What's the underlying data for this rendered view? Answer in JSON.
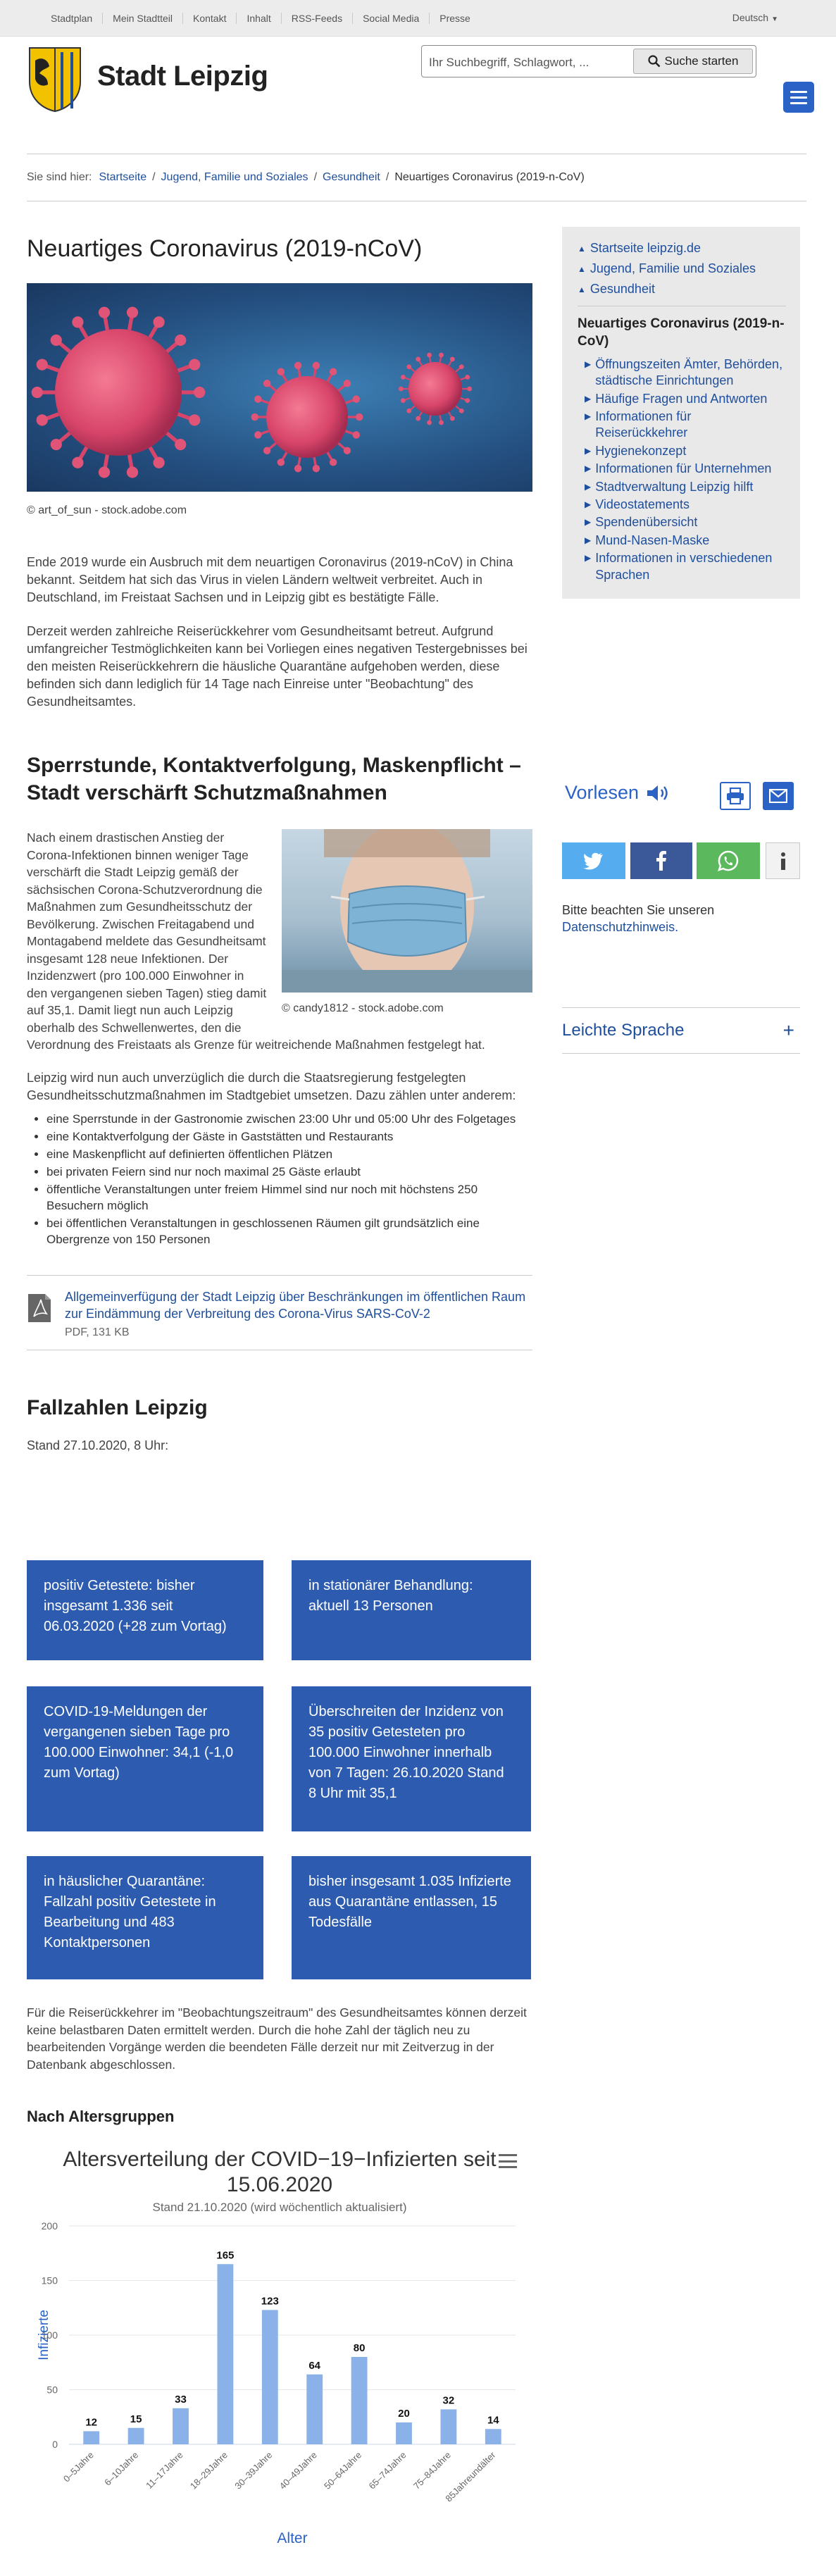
{
  "topbar": {
    "links": [
      "Stadtplan",
      "Mein Stadtteil",
      "Kontakt",
      "Inhalt",
      "RSS-Feeds",
      "Social Media",
      "Presse"
    ],
    "language": "Deutsch"
  },
  "header": {
    "brand": "Stadt Leipzig",
    "search_placeholder": "Ihr Suchbegriff, Schlagwort, ...",
    "search_button": "Suche starten"
  },
  "breadcrumb": {
    "label": "Sie sind hier:",
    "items": [
      "Startseite",
      "Jugend, Familie und Soziales",
      "Gesundheit"
    ],
    "current": "Neuartiges Coronavirus (2019-n-CoV)"
  },
  "main": {
    "title": "Neuartiges Coronavirus (2019-nCoV)",
    "hero_caption": "© art_of_sun - stock.adobe.com",
    "intro_p1": "Ende 2019 wurde ein Ausbruch mit dem neuartigen Coronavirus (2019-nCoV) in China bekannt. Seitdem hat sich das Virus in vielen Ländern weltweit verbreitet. Auch in Deutschland, im Freistaat Sachsen und in Leipzig gibt es bestätigte Fälle.",
    "intro_p2": "Derzeit werden zahlreiche Reiserückkehrer vom Gesundheitsamt betreut. Aufgrund umfangreicher Testmöglichkeiten kann bei Vorliegen eines negativen Testergebnisses bei den meisten Reiserückkehrern die häusliche Quarantäne aufgehoben werden, diese befinden sich dann lediglich für 14 Tage nach Einreise unter \"Beobachtung\" des Gesundheitsamtes.",
    "section2_title": "Sperrstunde, Kontaktverfolgung, Maskenpflicht – Stadt verschärft Schutzmaßnahmen",
    "mask_caption": "© candy1812 - stock.adobe.com",
    "section2_p1": "Nach einem drastischen Anstieg der Corona-Infektionen binnen weniger Tage verschärft die Stadt Leipzig gemäß der sächsischen Corona-Schutzverordnung die Maßnahmen zum Gesundheitsschutz der Bevölkerung. Zwischen Freitagabend und Montagabend meldete das Gesundheitsamt insgesamt 128 neue Infektionen. Der Inzidenzwert (pro 100.000 Einwohner in den vergangenen sieben Tagen) stieg damit auf 35,1. Damit liegt nun auch Leipzig oberhalb des Schwellenwertes, den die Verordnung des Freistaats als Grenze für weitreichende Maßnahmen festgelegt hat.",
    "section2_p2": "Leipzig wird nun auch unverzüglich die durch die Staatsregierung festgelegten Gesundheitsschutzmaßnahmen im Stadtgebiet umsetzen. Dazu zählen unter anderem:",
    "measures": [
      "eine Sperrstunde in der Gastronomie zwischen 23:00 Uhr und 05:00 Uhr des Folgetages",
      "eine Kontaktverfolgung der Gäste in Gaststätten und Restaurants",
      "eine Maskenpflicht auf definierten öffentlichen Plätzen",
      "bei privaten Feiern sind nur noch maximal 25 Gäste erlaubt",
      "öffentliche Veranstaltungen unter freiem Himmel sind nur noch mit höchstens 250 Besuchern möglich",
      "bei öffentlichen Veranstaltungen in geschlossenen Räumen gilt grundsätzlich eine Obergrenze von 150 Personen"
    ],
    "download_title": "Allgemeinverfügung der Stadt Leipzig über Beschränkungen im öffentlichen Raum zur Eindämmung der Verbreitung des Corona-Virus SARS-CoV-2",
    "download_meta": "PDF, 131 KB",
    "fallzahlen_title": "Fallzahlen Leipzig",
    "stand": "Stand 27.10.2020, 8 Uhr:",
    "boxes": [
      "positiv Getestete: bisher insgesamt 1.336 seit 06.03.2020 (+28 zum Vortag)",
      "in stationärer Behandlung: aktuell 13 Personen",
      "COVID-19-Meldungen der vergangenen sieben Tage pro 100.000 Einwohner: 34,1 (-1,0 zum Vortag)",
      "Überschreiten der Inzidenz von 35 positiv Getesteten pro 100.000 Einwohner innerhalb von 7 Tagen: 26.10.2020 Stand 8 Uhr mit 35,1",
      "in häuslicher Quarantäne: Fallzahl positiv Getestete in Bearbeitung und 483 Kontaktpersonen",
      "bisher insgesamt 1.035 Infizierte aus Quarantäne entlassen, 15 Todesfälle"
    ],
    "note": "Für die Reiserückkehrer im \"Beobachtungszeitraum\" des Gesundheitsamtes können derzeit keine belastbaren Daten ermittelt werden. Durch die hohe Zahl der täglich neu zu bearbeitenden Vorgänge werden die beendeten Fälle derzeit nur mit Zeitverzug in der Datenbank abgeschlossen.",
    "age_title": "Nach Altersgruppen"
  },
  "sidebar": {
    "up_links": [
      "Startseite leipzig.de",
      "Jugend, Familie und Soziales",
      "Gesundheit"
    ],
    "current": "Neuartiges Coronavirus (2019-n-CoV)",
    "sub_links": [
      "Öffnungszeiten Ämter, Behörden, städtische Einrichtungen",
      "Häufige Fragen und Antworten",
      "Informationen für Reiserückkehrer",
      "Hygienekonzept",
      "Informationen für Unternehmen",
      "Stadtverwaltung Leipzig hilft",
      "Videostatements",
      "Spendenübersicht",
      "Mund-Nasen-Maske",
      "Informationen in verschiedenen Sprachen"
    ],
    "vorlesen": "Vorlesen",
    "privacy_text": "Bitte beachten Sie unseren",
    "privacy_link": "Datenschutzhinweis.",
    "leichte_sprache": "Leichte Sprache"
  },
  "colors": {
    "primary": "#2c5bb0",
    "link": "#1f4f9c",
    "bar": "#8bb2e8",
    "twitter": "#55acee",
    "facebook": "#3b5998",
    "whatsapp": "#5cb85c"
  },
  "chart_data": {
    "type": "bar",
    "title": "Altersverteilung der COVID−19−Infizierten seit 15.06.2020",
    "subtitle": "Stand 21.10.2020 (wird wöchentlich aktualisiert)",
    "xlabel": "Alter",
    "ylabel": "Infizierte",
    "categories": [
      "0–5Jahre",
      "6–10Jahre",
      "11–17Jahre",
      "18–29Jahre",
      "30–39Jahre",
      "40–49Jahre",
      "50–64Jahre",
      "65–74Jahre",
      "75–84Jahre",
      "85Jahreundälter"
    ],
    "values": [
      12,
      15,
      33,
      165,
      123,
      64,
      80,
      20,
      32,
      14
    ],
    "yticks": [
      0,
      50,
      100,
      150,
      200
    ],
    "ylim": [
      0,
      200
    ],
    "grid": true,
    "data_labels": true
  }
}
